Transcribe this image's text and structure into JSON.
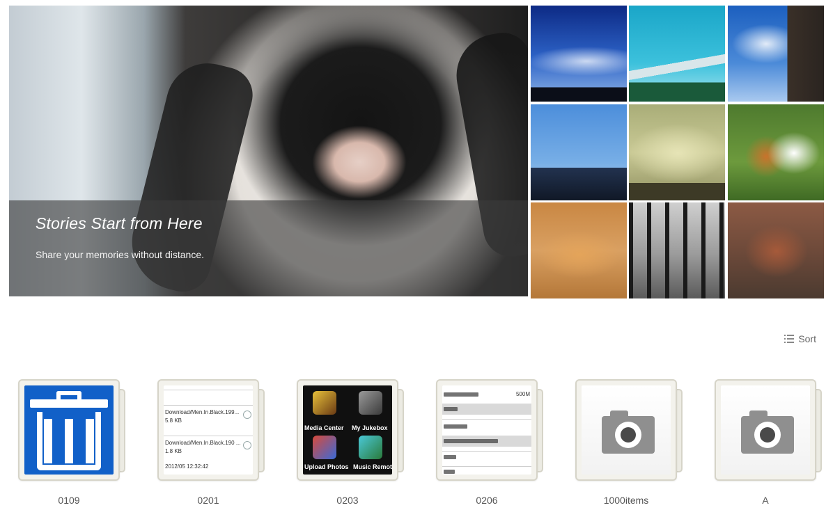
{
  "hero": {
    "title": "Stories Start from Here",
    "subtitle": "Share your memories without distance."
  },
  "gallery": {
    "thumbnails": [
      "sky-silhouette",
      "teal-sky-bridge",
      "sky-tower",
      "harbor-boats",
      "foggy-field",
      "hamster",
      "sleeping-cat",
      "tree-lined-path",
      "canyon-rocks"
    ]
  },
  "toolbar": {
    "sort_label": "Sort",
    "sort_icon": "list-icon"
  },
  "folders": [
    {
      "name": "0109",
      "thumbnail": "trash-icon"
    },
    {
      "name": "0201",
      "thumbnail": "file-list-screenshot"
    },
    {
      "name": "0203",
      "thumbnail": "app-menu-screenshot"
    },
    {
      "name": "0206",
      "thumbnail": "settings-list-screenshot"
    },
    {
      "name": "1000items",
      "thumbnail": "camera-icon"
    },
    {
      "name": "A",
      "thumbnail": "camera-icon"
    }
  ],
  "folder_0201_lines": {
    "l1": "Download/Men.In.Black.199...",
    "l2": "5.8 KB",
    "l3": "Download/Men.In.Black.190 ...",
    "l4": "1.8 KB",
    "l5": "2012/05 12:32:42"
  },
  "folder_0203_apps": {
    "a1": "Media Center",
    "a2": "My Jukebox",
    "a3": "Upload Photos",
    "a4": "Music Remote"
  },
  "folder_0206_header": "500M"
}
